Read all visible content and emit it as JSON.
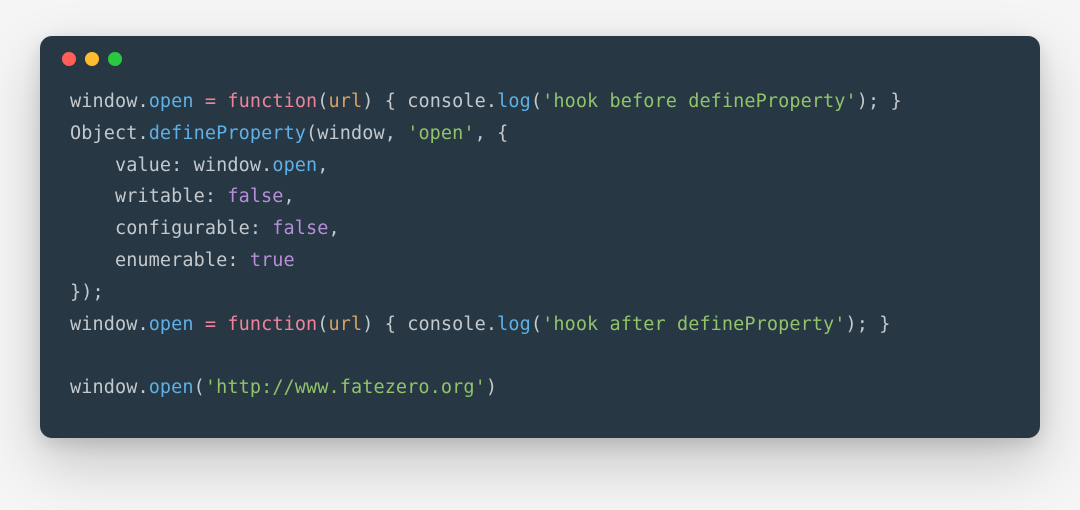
{
  "window": {
    "traffic_lights": {
      "red": "#ff5f57",
      "yellow": "#febc2e",
      "green": "#28c840"
    },
    "bg": "#273844"
  },
  "code": {
    "l1": {
      "t1": "window",
      "t2": ".",
      "t3": "open",
      "t4": " ",
      "t5": "=",
      "t6": " ",
      "t7": "function",
      "t8": "(",
      "t9": "url",
      "t10": ") { ",
      "t11": "console",
      "t12": ".",
      "t13": "log",
      "t14": "(",
      "t15": "'hook before defineProperty'",
      "t16": "); }"
    },
    "l2": {
      "t1": "Object",
      "t2": ".",
      "t3": "defineProperty",
      "t4": "(",
      "t5": "window",
      "t6": ", ",
      "t7": "'open'",
      "t8": ", {"
    },
    "l3": {
      "indent": "    ",
      "t1": "value",
      "t2": ": ",
      "t3": "window",
      "t4": ".",
      "t5": "open",
      "t6": ","
    },
    "l4": {
      "indent": "    ",
      "t1": "writable",
      "t2": ": ",
      "t3": "false",
      "t4": ","
    },
    "l5": {
      "indent": "    ",
      "t1": "configurable",
      "t2": ": ",
      "t3": "false",
      "t4": ","
    },
    "l6": {
      "indent": "    ",
      "t1": "enumerable",
      "t2": ": ",
      "t3": "true"
    },
    "l7": {
      "t1": "});"
    },
    "l8": {
      "t1": "window",
      "t2": ".",
      "t3": "open",
      "t4": " ",
      "t5": "=",
      "t6": " ",
      "t7": "function",
      "t8": "(",
      "t9": "url",
      "t10": ") { ",
      "t11": "console",
      "t12": ".",
      "t13": "log",
      "t14": "(",
      "t15": "'hook after defineProperty'",
      "t16": "); }"
    },
    "l9": {
      "blank": " "
    },
    "l10": {
      "t1": "window",
      "t2": ".",
      "t3": "open",
      "t4": "(",
      "t5": "'http://www.fatezero.org'",
      "t6": ")"
    }
  }
}
